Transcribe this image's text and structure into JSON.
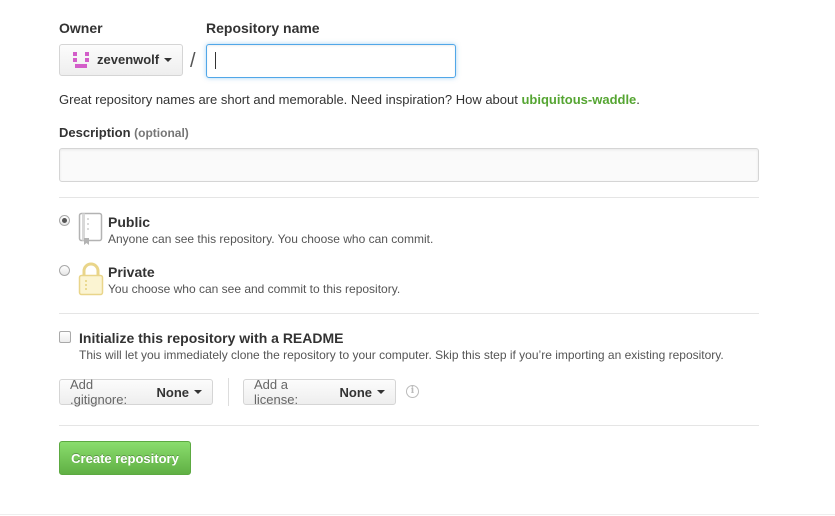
{
  "owner": {
    "label": "Owner",
    "selected": "zevenwolf",
    "avatar_color": "#d35ec9"
  },
  "repository": {
    "label": "Repository name",
    "separator": "/",
    "value": ""
  },
  "hint": {
    "text": "Great repository names are short and memorable. Need inspiration? How about ",
    "suggestion": "ubiquitous-waddle",
    "suffix": ".",
    "suggestion_color": "#55a532"
  },
  "description": {
    "label": "Description",
    "optional": "(optional)",
    "value": ""
  },
  "visibility": {
    "selected": "public",
    "options": [
      {
        "id": "public",
        "title": "Public",
        "description": "Anyone can see this repository. You choose who can commit.",
        "icon": "repo-book-icon"
      },
      {
        "id": "private",
        "title": "Private",
        "description": "You choose who can see and commit to this repository.",
        "icon": "lock-icon"
      }
    ]
  },
  "init_readme": {
    "checked": false,
    "title": "Initialize this repository with a README",
    "description": "This will let you immediately clone the repository to your computer. Skip this step if you’re importing an existing repository."
  },
  "gitignore": {
    "label": "Add .gitignore:",
    "value": "None"
  },
  "license": {
    "label": "Add a license:",
    "value": "None"
  },
  "info_icon": "info-icon",
  "create_button": {
    "label": "Create repository",
    "color": "#60b044"
  }
}
